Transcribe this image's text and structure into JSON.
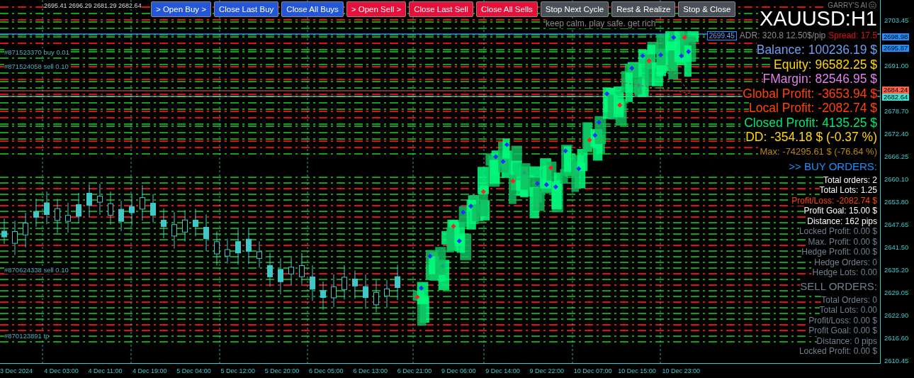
{
  "quote": {
    "symbol_values": "2695.41 2696.29 2681.29 2682.64"
  },
  "buttons": [
    {
      "label": "> Open Buy >",
      "kind": "buy"
    },
    {
      "label": "Close Last Buy",
      "kind": "buy"
    },
    {
      "label": "Close All Buys",
      "kind": "buy"
    },
    {
      "label": "> Open Sell >",
      "kind": "sell"
    },
    {
      "label": "Close Last Sell",
      "kind": "sell"
    },
    {
      "label": "Close All Sells",
      "kind": "sell"
    },
    {
      "label": "Stop Next Cycle",
      "kind": "control"
    },
    {
      "label": "Rest & Realize",
      "kind": "control"
    },
    {
      "label": "Stop & Close",
      "kind": "control"
    }
  ],
  "brand": "GARRY'S AI",
  "motto": "keep calm. play safe. get rich",
  "chart_title": "XAUUSD:H1",
  "adr_row": {
    "price": "2699.45",
    "adr": "ADR: 320.8  12.50$/pip",
    "spread": "Spread: 17.5"
  },
  "order_labels": [
    {
      "text": "#871523370 buy 0.01"
    },
    {
      "text": "#871524058 sell 0.10"
    },
    {
      "text": "#870624338 sell 0.10"
    },
    {
      "text": "#870123891 tp"
    }
  ],
  "stats": [
    {
      "text": "Balance: 100236.19 $",
      "kind": "large",
      "color": "#6f9df0"
    },
    {
      "text": "Equity: 96582.25 $",
      "kind": "large",
      "color": "#ffd700"
    },
    {
      "text": "FMargin: 82546.95 $",
      "kind": "large",
      "color": "#e080e8"
    },
    {
      "text": "Global Profit: -3653.94 $",
      "kind": "large",
      "color": "#ff4500"
    },
    {
      "text": "Local Profit: -2082.74 $",
      "kind": "large",
      "color": "#ff4500"
    },
    {
      "text": "Closed Profit: 4135.25 $",
      "kind": "large",
      "color": "#00e676"
    },
    {
      "text": "DD: -354.18 $ (-0.37 %)",
      "kind": "large",
      "color": "#ffd700"
    },
    {
      "text": "Max: -74295.61 $ (-76.64 %)",
      "kind": "medium",
      "color": "#b8860b"
    },
    {
      "text": ">> BUY ORDERS:",
      "kind": "header",
      "color": "#1e90ff"
    },
    {
      "text": "Total orders: 2",
      "kind": "small",
      "color": "#ffffff"
    },
    {
      "text": "Total Lots: 1.25",
      "kind": "small",
      "color": "#ffffff"
    },
    {
      "text": "Profit/Loss: -2082.74 $",
      "kind": "small",
      "color": "#ff4500"
    },
    {
      "text": "Profit Goal: 15.00 $",
      "kind": "small",
      "color": "#ffffff"
    },
    {
      "text": "Distance: 162 pips",
      "kind": "small",
      "color": "#ffffff"
    },
    {
      "text": "Locked Profit: 0.00 $",
      "kind": "small",
      "color": "#708090"
    },
    {
      "text": "Max. Profit: 0.00 $",
      "kind": "small",
      "color": "#708090"
    },
    {
      "text": "Hedge Profit: 0.00 $",
      "kind": "small",
      "color": "#708090"
    },
    {
      "text": "Hedge Orders: 0",
      "kind": "small",
      "color": "#708090"
    },
    {
      "text": "Hedge Lots: 0.00",
      "kind": "small",
      "color": "#708090"
    },
    {
      "text": "SELL ORDERS:",
      "kind": "header",
      "color": "#708090"
    },
    {
      "text": "Total Orders: 0",
      "kind": "small",
      "color": "#708090"
    },
    {
      "text": "Total Lots: 0.00",
      "kind": "small",
      "color": "#708090"
    },
    {
      "text": "Profit/Loss: 0.00 $",
      "kind": "small",
      "color": "#708090"
    },
    {
      "text": "Profit Goal: 0.00 $",
      "kind": "small",
      "color": "#708090"
    },
    {
      "text": "Distance: 0 pips",
      "kind": "small",
      "color": "#708090"
    },
    {
      "text": "Locked Profit: 0.00 $",
      "kind": "small",
      "color": "#708090"
    }
  ],
  "price_axis": [
    "2703.45",
    "2691.00",
    "2678.70",
    "2672.40",
    "2666.25",
    "2660.10",
    "2653.80",
    "2647.65",
    "2641.50",
    "2635.20",
    "2629.05",
    "2622.90",
    "2616.60",
    "2610.45"
  ],
  "price_marks": [
    {
      "text": "2698.98",
      "color": "#1e90ff"
    },
    {
      "text": "2695.87",
      "color": "#1e90ff"
    },
    {
      "text": "2684.24",
      "color": "#ff6347"
    },
    {
      "text": "2682.64",
      "color": "#40e0d0"
    }
  ],
  "time_axis": [
    "3 Dec 2024",
    "4 Dec 03:00",
    "4 Dec 11:00",
    "4 Dec 19:00",
    "5 Dec 04:00",
    "5 Dec 12:00",
    "5 Dec 20:00",
    "6 Dec 05:00",
    "6 Dec 13:00",
    "6 Dec 21:00",
    "9 Dec 06:00",
    "9 Dec 14:00",
    "9 Dec 22:00",
    "10 Dec 07:00",
    "10 Dec 15:00",
    "10 Dec 23:00"
  ]
}
